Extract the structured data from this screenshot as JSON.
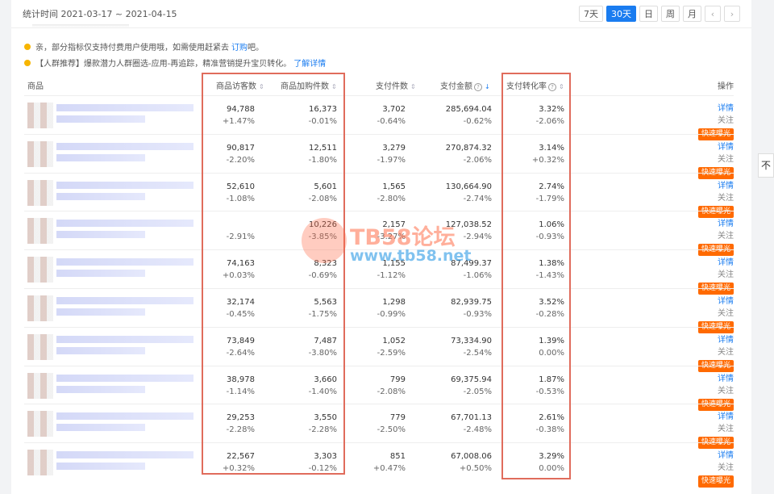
{
  "header": {
    "stat_range": "统计时间 2021-03-17 ~ 2021-04-15",
    "ranges": [
      "7天",
      "30天",
      "日",
      "周",
      "月"
    ],
    "active_range": "30天"
  },
  "notices": [
    {
      "text": "亲，部分指标仅支持付费用户使用哦，如需使用赶紧去",
      "link": "订购",
      "suffix": "吧。"
    },
    {
      "text": "【人群推荐】爆款潜力人群圈选-应用-再追踪，精准营销提升宝贝转化。",
      "link": "了解详情",
      "suffix": ""
    }
  ],
  "columns": {
    "product": "商品",
    "visitors": "商品访客数",
    "cart": "商品加购件数",
    "pay_items": "支付件数",
    "pay_amount": "支付金额",
    "conversion": "支付转化率",
    "ops": "操作"
  },
  "actions": {
    "detail": "详情",
    "follow": "关注",
    "promote": "快速曝光"
  },
  "rows": [
    {
      "visitors": "94,788",
      "visitors_d": "+1.47%",
      "cart": "16,373",
      "cart_d": "-0.01%",
      "items": "3,702",
      "items_d": "-0.64%",
      "amount": "285,694.04",
      "amount_d": "-0.62%",
      "conv": "3.32%",
      "conv_d": "-2.06%"
    },
    {
      "visitors": "90,817",
      "visitors_d": "-2.20%",
      "cart": "12,511",
      "cart_d": "-1.80%",
      "items": "3,279",
      "items_d": "-1.97%",
      "amount": "270,874.32",
      "amount_d": "-2.06%",
      "conv": "3.14%",
      "conv_d": "+0.32%"
    },
    {
      "visitors": "52,610",
      "visitors_d": "-1.08%",
      "cart": "5,601",
      "cart_d": "-2.08%",
      "items": "1,565",
      "items_d": "-2.80%",
      "amount": "130,664.90",
      "amount_d": "-2.74%",
      "conv": "2.74%",
      "conv_d": "-1.79%"
    },
    {
      "visitors": "",
      "visitors_d": "-2.91%",
      "cart": "10,226",
      "cart_d": "-3.85%",
      "items": "2,157",
      "items_d": "-3.27%",
      "amount": "127,038.52",
      "amount_d": "-2.94%",
      "conv": "1.06%",
      "conv_d": "-0.93%"
    },
    {
      "visitors": "74,163",
      "visitors_d": "+0.03%",
      "cart": "8,323",
      "cart_d": "-0.69%",
      "items": "1,155",
      "items_d": "-1.12%",
      "amount": "87,499.37",
      "amount_d": "-1.06%",
      "conv": "1.38%",
      "conv_d": "-1.43%"
    },
    {
      "visitors": "32,174",
      "visitors_d": "-0.45%",
      "cart": "5,563",
      "cart_d": "-1.75%",
      "items": "1,298",
      "items_d": "-0.99%",
      "amount": "82,939.75",
      "amount_d": "-0.93%",
      "conv": "3.52%",
      "conv_d": "-0.28%"
    },
    {
      "visitors": "73,849",
      "visitors_d": "-2.64%",
      "cart": "7,487",
      "cart_d": "-3.80%",
      "items": "1,052",
      "items_d": "-2.59%",
      "amount": "73,334.90",
      "amount_d": "-2.54%",
      "conv": "1.39%",
      "conv_d": "0.00%"
    },
    {
      "visitors": "38,978",
      "visitors_d": "-1.14%",
      "cart": "3,660",
      "cart_d": "-1.40%",
      "items": "799",
      "items_d": "-2.08%",
      "amount": "69,375.94",
      "amount_d": "-2.05%",
      "conv": "1.87%",
      "conv_d": "-0.53%"
    },
    {
      "visitors": "29,253",
      "visitors_d": "-2.28%",
      "cart": "3,550",
      "cart_d": "-2.28%",
      "items": "779",
      "items_d": "-2.50%",
      "amount": "67,701.13",
      "amount_d": "-2.48%",
      "conv": "2.61%",
      "conv_d": "-0.38%"
    },
    {
      "visitors": "22,567",
      "visitors_d": "+0.32%",
      "cart": "3,303",
      "cart_d": "-0.12%",
      "items": "851",
      "items_d": "+0.47%",
      "amount": "67,008.06",
      "amount_d": "+0.50%",
      "conv": "3.29%",
      "conv_d": "0.00%"
    }
  ],
  "watermark": {
    "brand": "TB58论坛",
    "url": "www.tb58.net"
  },
  "side_tab": "不",
  "colors": {
    "accent": "#1a7cf0",
    "promote": "#ff6a00",
    "highlight": "#e06c5c"
  }
}
